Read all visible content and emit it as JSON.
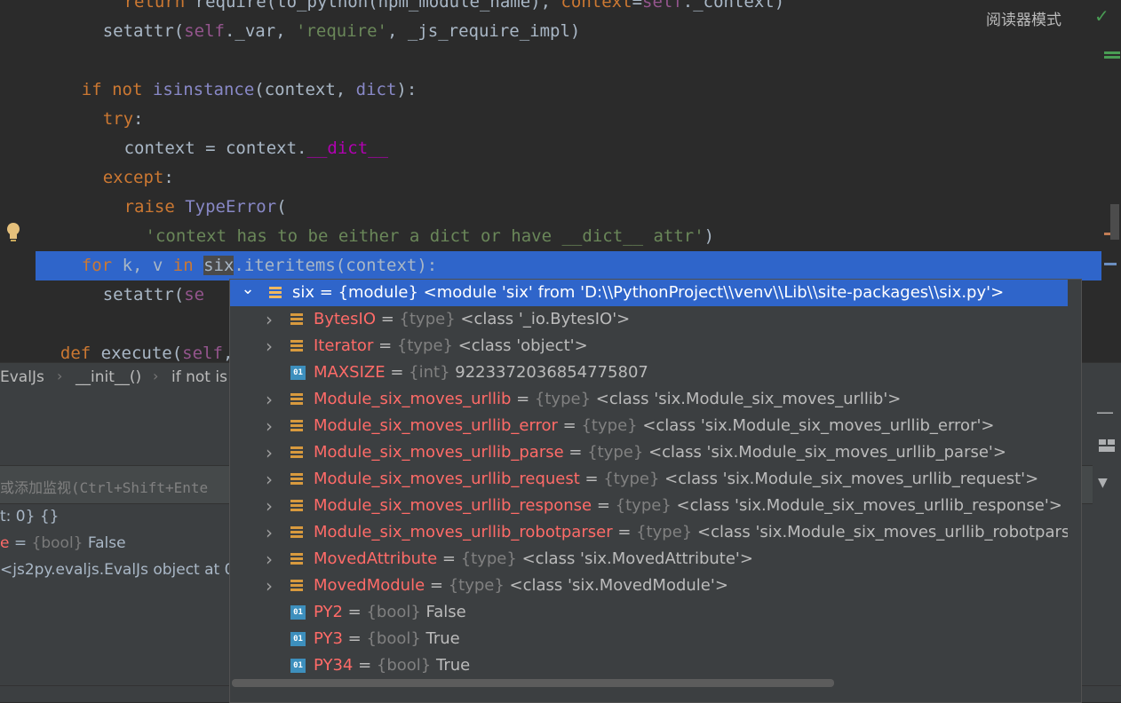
{
  "editor": {
    "reader_mode": "阅读器模式",
    "lines": [
      {
        "indent": "        ",
        "parts": [
          [
            "kw",
            "return "
          ],
          [
            "plain",
            "require(to_python(npm_module_name), "
          ],
          [
            "kw",
            "context"
          ],
          [
            "plain",
            "="
          ],
          [
            "self",
            "self"
          ],
          [
            "plain",
            "._context)"
          ]
        ]
      },
      {
        "indent": "      ",
        "parts": [
          [
            "plain",
            "setattr("
          ],
          [
            "self",
            "self"
          ],
          [
            "plain",
            "._var, "
          ],
          [
            "str",
            "'require'"
          ],
          [
            "plain",
            ", _js_require_impl)"
          ]
        ]
      },
      {
        "indent": "",
        "parts": []
      },
      {
        "indent": "    ",
        "parts": [
          [
            "kw",
            "if not "
          ],
          [
            "builtin",
            "isinstance"
          ],
          [
            "plain",
            "(context, "
          ],
          [
            "builtin",
            "dict"
          ],
          [
            "plain",
            "):"
          ]
        ]
      },
      {
        "indent": "      ",
        "parts": [
          [
            "kw",
            "try"
          ],
          [
            "plain",
            ":"
          ]
        ]
      },
      {
        "indent": "        ",
        "parts": [
          [
            "plain",
            "context = context."
          ],
          [
            "dunder",
            "__dict__"
          ]
        ]
      },
      {
        "indent": "      ",
        "parts": [
          [
            "kw",
            "except"
          ],
          [
            "plain",
            ":"
          ]
        ]
      },
      {
        "indent": "        ",
        "parts": [
          [
            "kw",
            "raise "
          ],
          [
            "builtin",
            "TypeError"
          ],
          [
            "plain",
            "("
          ]
        ]
      },
      {
        "indent": "          ",
        "parts": [
          [
            "str",
            "'context has to be either a dict or have __dict__ attr'"
          ],
          [
            "plain",
            ")"
          ]
        ]
      },
      {
        "indent": "    ",
        "parts": [
          [
            "kw",
            "for "
          ],
          [
            "plain",
            "k, v "
          ],
          [
            "kw",
            "in "
          ],
          [
            "six",
            "six"
          ],
          [
            "plain",
            ".iteritems(context):"
          ]
        ]
      },
      {
        "indent": "      ",
        "parts": [
          [
            "plain",
            "setattr("
          ],
          [
            "self",
            "se"
          ]
        ]
      },
      {
        "indent": "",
        "parts": []
      },
      {
        "indent": "  ",
        "parts": [
          [
            "kw",
            "def "
          ],
          [
            "plain",
            "execute("
          ],
          [
            "self",
            "self"
          ],
          [
            "plain",
            ","
          ]
        ]
      }
    ]
  },
  "breadcrumb": {
    "items": [
      "EvalJs",
      "__init__()",
      "if not is"
    ]
  },
  "debug": {
    "watch_placeholder": "或添加监视(Ctrl+Shift+Ente",
    "vars": [
      [
        [
          "plain",
          "t: 0} {}"
        ]
      ],
      [
        [
          "red",
          "e"
        ],
        [
          "plain",
          " = "
        ],
        [
          "type",
          "{bool}"
        ],
        [
          "plain",
          " False"
        ]
      ],
      [
        [
          "plain",
          "<js2py.evaljs.EvalJs object at 0"
        ]
      ]
    ]
  },
  "popup": {
    "rows": [
      {
        "arrow": "down",
        "icon": "class",
        "name": "six",
        "sep": " = ",
        "type": "{module}",
        "value": " <module 'six' from 'D:\\\\PythonProject\\\\venv\\\\Lib\\\\site-packages\\\\six.py'>",
        "selected": true,
        "level": 0
      },
      {
        "arrow": "right",
        "icon": "class",
        "name": "BytesIO",
        "sep": " = ",
        "type": "{type}",
        "value": " <class '_io.BytesIO'>",
        "level": 1
      },
      {
        "arrow": "right",
        "icon": "class",
        "name": "Iterator",
        "sep": " = ",
        "type": "{type}",
        "value": " <class 'object'>",
        "level": 1
      },
      {
        "arrow": "none",
        "icon": "field",
        "name": "MAXSIZE",
        "sep": " = ",
        "type": "{int}",
        "value": " 9223372036854775807",
        "level": 1
      },
      {
        "arrow": "right",
        "icon": "class",
        "name": "Module_six_moves_urllib",
        "sep": " = ",
        "type": "{type}",
        "value": " <class 'six.Module_six_moves_urllib'>",
        "level": 1
      },
      {
        "arrow": "right",
        "icon": "class",
        "name": "Module_six_moves_urllib_error",
        "sep": " = ",
        "type": "{type}",
        "value": " <class 'six.Module_six_moves_urllib_error'>",
        "level": 1
      },
      {
        "arrow": "right",
        "icon": "class",
        "name": "Module_six_moves_urllib_parse",
        "sep": " = ",
        "type": "{type}",
        "value": " <class 'six.Module_six_moves_urllib_parse'>",
        "level": 1
      },
      {
        "arrow": "right",
        "icon": "class",
        "name": "Module_six_moves_urllib_request",
        "sep": " = ",
        "type": "{type}",
        "value": " <class 'six.Module_six_moves_urllib_request'>",
        "level": 1
      },
      {
        "arrow": "right",
        "icon": "class",
        "name": "Module_six_moves_urllib_response",
        "sep": " = ",
        "type": "{type}",
        "value": " <class 'six.Module_six_moves_urllib_response'>",
        "level": 1
      },
      {
        "arrow": "right",
        "icon": "class",
        "name": "Module_six_moves_urllib_robotparser",
        "sep": " = ",
        "type": "{type}",
        "value": " <class 'six.Module_six_moves_urllib_robotparser'>",
        "level": 1
      },
      {
        "arrow": "right",
        "icon": "class",
        "name": "MovedAttribute",
        "sep": " = ",
        "type": "{type}",
        "value": " <class 'six.MovedAttribute'>",
        "level": 1
      },
      {
        "arrow": "right",
        "icon": "class",
        "name": "MovedModule",
        "sep": " = ",
        "type": "{type}",
        "value": " <class 'six.MovedModule'>",
        "level": 1
      },
      {
        "arrow": "none",
        "icon": "field",
        "name": "PY2",
        "sep": " = ",
        "type": "{bool}",
        "value": " False",
        "level": 1
      },
      {
        "arrow": "none",
        "icon": "field",
        "name": "PY3",
        "sep": " = ",
        "type": "{bool}",
        "value": " True",
        "level": 1
      },
      {
        "arrow": "none",
        "icon": "field",
        "name": "PY34",
        "sep": " = ",
        "type": "{bool}",
        "value": " True",
        "level": 1
      }
    ]
  }
}
